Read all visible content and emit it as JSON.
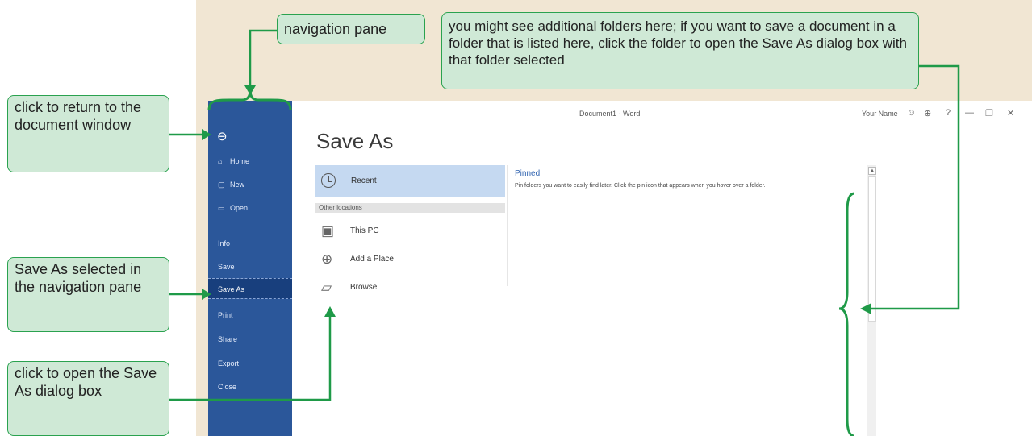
{
  "window": {
    "title": "Document1 - Word",
    "user_name": "Your Name"
  },
  "titlebar_icons": [
    "smiley-icon",
    "globe-icon",
    "help-icon",
    "minimize-icon",
    "restore-icon",
    "close-icon"
  ],
  "titlebar_glyphs": {
    "smiley": "☺",
    "globe": "⊕",
    "help": "?",
    "minimize": "—",
    "restore": "❐",
    "close": "✕"
  },
  "nav": {
    "back_glyph": "⊖",
    "items": [
      {
        "label": "Home",
        "icon": "⌂"
      },
      {
        "label": "New",
        "icon": "▢"
      },
      {
        "label": "Open",
        "icon": "▭"
      },
      {
        "label": "Info",
        "icon": ""
      },
      {
        "label": "Save",
        "icon": ""
      },
      {
        "label": "Save As",
        "icon": ""
      },
      {
        "label": "Print",
        "icon": ""
      },
      {
        "label": "Share",
        "icon": ""
      },
      {
        "label": "Export",
        "icon": ""
      },
      {
        "label": "Close",
        "icon": ""
      }
    ],
    "selected": "Save As"
  },
  "page_title": "Save As",
  "locations": {
    "recent_label": "Recent",
    "other_header": "Other locations",
    "items": [
      {
        "label": "This PC",
        "icon": "▣"
      },
      {
        "label": "Add a Place",
        "icon": "⊕"
      },
      {
        "label": "Browse",
        "icon": "▱"
      }
    ]
  },
  "pinned": {
    "title": "Pinned",
    "description": "Pin folders you want to easily find later. Click the pin icon that appears when you hover over a folder."
  },
  "scroll_up_glyph": "▲",
  "callouts": {
    "navigation_pane": "navigation pane",
    "additional_folders": "you might see additional folders here; if you want to save a document in a folder that is listed here, click the folder to open the Save As dialog box with that folder selected",
    "return": "click to return to the document window",
    "save_as_selected": "Save As selected in the navigation pane",
    "open_dialog": "click to open the Save As dialog box"
  },
  "colors": {
    "nav_bg": "#2b579a",
    "callout_bg": "#cfe9d6",
    "callout_border": "#2aa24f",
    "backdrop": "#f1e6d3"
  }
}
